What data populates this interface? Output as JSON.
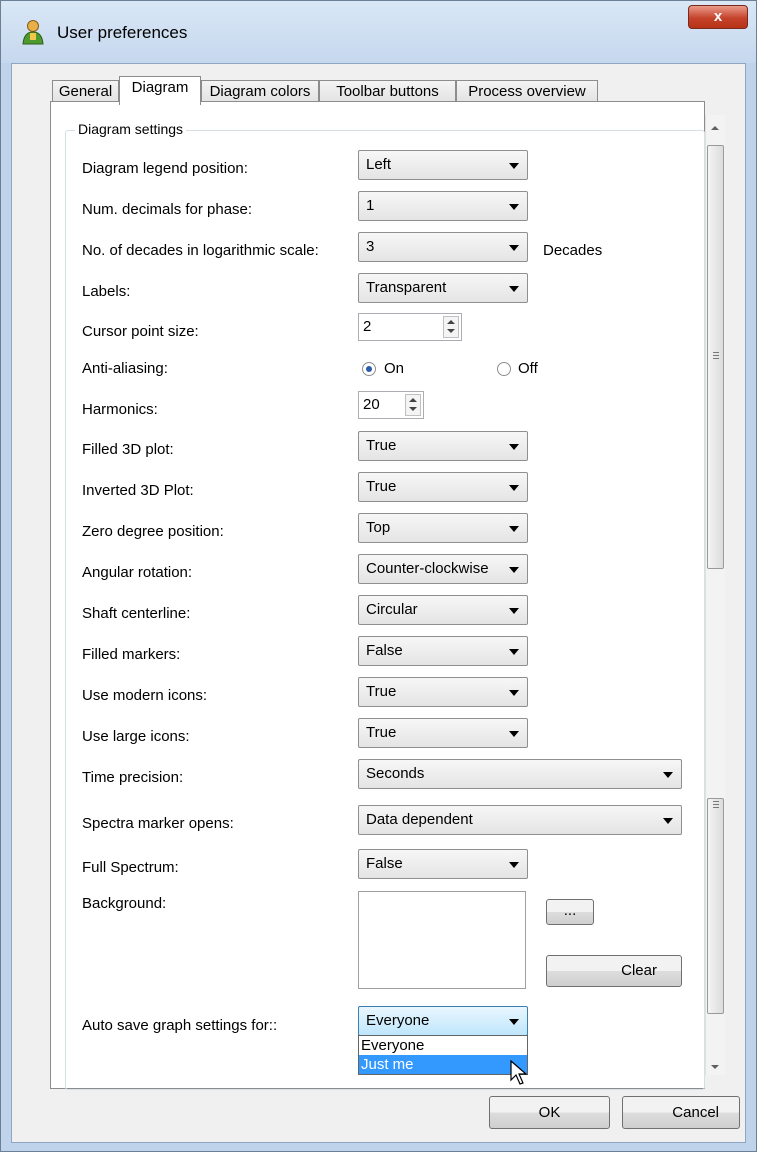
{
  "window": {
    "title": "User preferences",
    "close_label": "x"
  },
  "tabs": [
    {
      "label": "General",
      "active": false
    },
    {
      "label": "Diagram",
      "active": true
    },
    {
      "label": "Diagram colors",
      "active": false
    },
    {
      "label": "Toolbar buttons",
      "active": false
    },
    {
      "label": "Process overview",
      "active": false
    }
  ],
  "group": {
    "title": "Diagram settings"
  },
  "settings": {
    "legend_position": {
      "label": "Diagram legend position:",
      "value": "Left"
    },
    "decimals_phase": {
      "label": "Num. decimals for phase:",
      "value": "1"
    },
    "decades": {
      "label": "No. of decades in logarithmic scale:",
      "value": "3",
      "suffix": "Decades"
    },
    "labels": {
      "label": "Labels:",
      "value": "Transparent"
    },
    "cursor_size": {
      "label": "Cursor point size:",
      "value": "2"
    },
    "anti_aliasing": {
      "label": "Anti-aliasing:",
      "on_label": "On",
      "off_label": "Off",
      "selected": "On"
    },
    "harmonics": {
      "label": "Harmonics:",
      "value": "20"
    },
    "filled_3d": {
      "label": "Filled 3D plot:",
      "value": "True"
    },
    "inverted_3d": {
      "label": "Inverted 3D Plot:",
      "value": "True"
    },
    "zero_degree": {
      "label": "Zero degree position:",
      "value": "Top"
    },
    "angular_rotation": {
      "label": "Angular rotation:",
      "value": "Counter-clockwise"
    },
    "shaft_centerline": {
      "label": "Shaft centerline:",
      "value": "Circular"
    },
    "filled_markers": {
      "label": "Filled markers:",
      "value": "False"
    },
    "modern_icons": {
      "label": "Use modern icons:",
      "value": "True"
    },
    "large_icons": {
      "label": "Use large icons:",
      "value": "True"
    },
    "time_precision": {
      "label": "Time precision:",
      "value": "Seconds"
    },
    "spectra_marker": {
      "label": "Spectra marker opens:",
      "value": "Data dependent"
    },
    "full_spectrum": {
      "label": "Full Spectrum:",
      "value": "False"
    },
    "background": {
      "label": "Background:",
      "browse_label": "...",
      "clear_label": "Clear"
    },
    "auto_save": {
      "label": "Auto save graph settings for::",
      "value": "Everyone",
      "options": [
        "Everyone",
        "Just me"
      ],
      "highlighted": "Just me"
    }
  },
  "footer": {
    "ok_label": "OK",
    "cancel_label": "Cancel"
  }
}
